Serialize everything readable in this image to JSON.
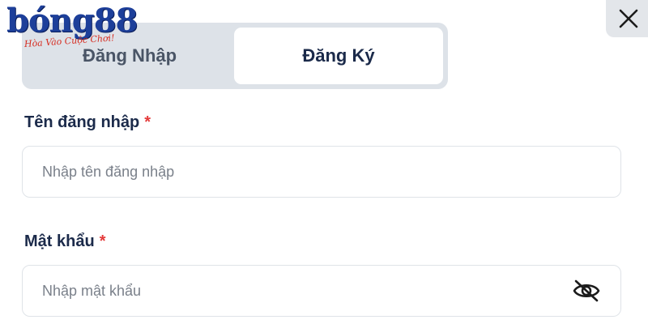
{
  "brand": {
    "logo_text": "bóng88",
    "tagline": "Hòa Vào Cuộc Chơi!",
    "primary_color": "#1d3f9a",
    "tagline_color": "#d62a1e"
  },
  "close_icon": "close-icon",
  "tabs": [
    {
      "label": "Đăng Nhập",
      "active": false
    },
    {
      "label": "Đăng Ký",
      "active": true
    }
  ],
  "form": {
    "username": {
      "label": "Tên đăng nhập",
      "required_mark": "*",
      "placeholder": "Nhập tên đăng nhập",
      "value": ""
    },
    "password": {
      "label": "Mật khẩu",
      "required_mark": "*",
      "placeholder": "Nhập mật khẩu",
      "value": "",
      "visibility_icon": "eye-off-icon"
    }
  },
  "colors": {
    "text": "#1b2a4a",
    "required": "#e43a3a",
    "tab_bar_bg": "#dde2e8",
    "input_border": "#dfe3e8"
  }
}
